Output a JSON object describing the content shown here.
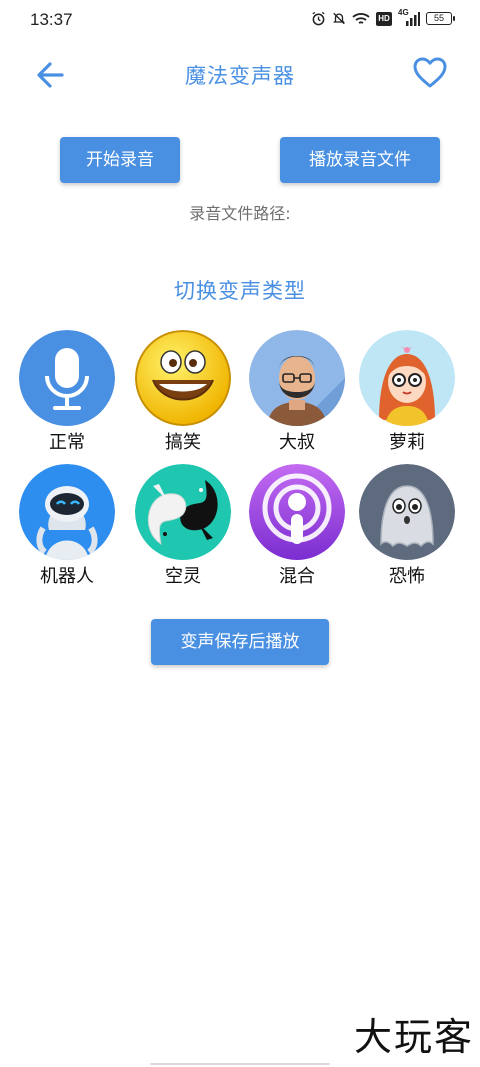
{
  "status_bar": {
    "time": "13:37",
    "hd": "HD",
    "network": "4G",
    "battery": "55",
    "icons": [
      "alarm-icon",
      "mute-bell-icon",
      "wifi-icon",
      "hd-icon",
      "signal-icon",
      "battery-icon"
    ]
  },
  "header": {
    "title": "魔法变声器",
    "back_icon": "arrow-left-icon",
    "favorite_icon": "heart-outline-icon"
  },
  "actions": {
    "start_record": "开始录音",
    "play_record": "播放录音文件",
    "path_label": "录音文件路径:",
    "save_play": "变声保存后播放"
  },
  "section": {
    "title": "切换变声类型"
  },
  "voices": [
    {
      "label": "正常",
      "icon": "microphone-icon",
      "color": "#4a90e2"
    },
    {
      "label": "搞笑",
      "icon": "laughing-emoji-icon",
      "color": "#ffd400"
    },
    {
      "label": "大叔",
      "icon": "bearded-man-icon",
      "color": "#8fb8e8"
    },
    {
      "label": "萝莉",
      "icon": "girl-with-glasses-icon",
      "color": "#bfe6f5"
    },
    {
      "label": "机器人",
      "icon": "robot-icon",
      "color": "#2e8ef0"
    },
    {
      "label": "空灵",
      "icon": "yin-yang-fish-icon",
      "color": "#1fc7b0"
    },
    {
      "label": "混合",
      "icon": "podcast-icon",
      "color": "#a03de0"
    },
    {
      "label": "恐怖",
      "icon": "ghost-icon",
      "color": "#5e6b7e"
    }
  ],
  "accent_color": "#4a90e2",
  "watermark": "大玩客"
}
